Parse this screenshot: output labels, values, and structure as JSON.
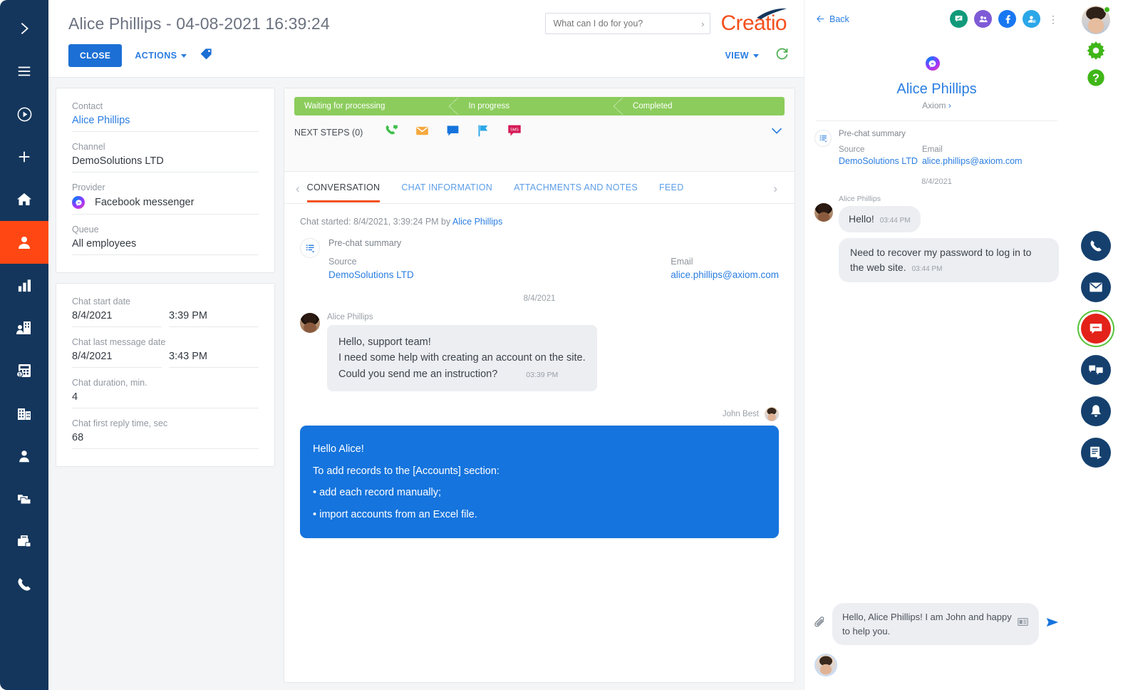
{
  "nav_rail": {
    "items": [
      {
        "name": "expand",
        "icon": "chevron-right-icon"
      },
      {
        "name": "menu",
        "icon": "hamburger-icon"
      },
      {
        "name": "run-process",
        "icon": "play-circle-icon"
      },
      {
        "name": "add",
        "icon": "plus-icon"
      },
      {
        "name": "home",
        "icon": "home-icon"
      },
      {
        "name": "contacts",
        "icon": "person-badge-icon",
        "active": true
      },
      {
        "name": "dashboards",
        "icon": "bar-chart-icon"
      },
      {
        "name": "accounts-people",
        "icon": "building-person-icon"
      },
      {
        "name": "invoices",
        "icon": "calculator-money-icon"
      },
      {
        "name": "companies",
        "icon": "buildings-icon"
      },
      {
        "name": "contact",
        "icon": "person-icon"
      },
      {
        "name": "cases",
        "icon": "folders-icon"
      },
      {
        "name": "portfolio",
        "icon": "briefcase-icon"
      },
      {
        "name": "calls",
        "icon": "phone-icon"
      }
    ]
  },
  "header": {
    "title": "Alice Phillips - 04-08-2021 16:39:24",
    "close_label": "CLOSE",
    "actions_label": "ACTIONS",
    "view_label": "VIEW",
    "tag_icon": "tag-icon",
    "refresh_icon": "refresh-icon",
    "logo_text": "Creatio"
  },
  "search": {
    "placeholder": "What can I do for you?",
    "value": ""
  },
  "info_card_1": {
    "fields": [
      {
        "label": "Contact",
        "value": "Alice Phillips",
        "link": true
      },
      {
        "label": "Channel",
        "value": "DemoSolutions LTD",
        "link": false
      },
      {
        "label": "Provider",
        "value": "Facebook messenger",
        "link": false,
        "icon": "messenger-icon"
      },
      {
        "label": "Queue",
        "value": "All employees",
        "link": false
      }
    ]
  },
  "info_card_2": {
    "chat_start_date_label": "Chat start date",
    "chat_start_date": "8/4/2021",
    "chat_start_time": "3:39 PM",
    "chat_last_message_date_label": "Chat last message date",
    "chat_last_message_date": "8/4/2021",
    "chat_last_message_time": "3:43 PM",
    "chat_duration_label": "Chat duration, min.",
    "chat_duration": "4",
    "chat_first_reply_label": "Chat first reply time, sec",
    "chat_first_reply": "68"
  },
  "process": {
    "stages": [
      {
        "label": "Waiting for processing",
        "color": "#8ccc5c"
      },
      {
        "label": "In progress",
        "color": "#8ccc5c"
      },
      {
        "label": "Completed",
        "color": "#8ccc5c"
      }
    ],
    "next_steps_label": "NEXT STEPS (0)",
    "action_icons": [
      {
        "name": "call-icon",
        "color": "#3fbf4a"
      },
      {
        "name": "email-icon",
        "color": "#f5a83c"
      },
      {
        "name": "message-icon",
        "color": "#1574dd"
      },
      {
        "name": "flag-icon",
        "color": "#2ba7e8"
      },
      {
        "name": "sms-icon",
        "color": "#d41a56"
      }
    ],
    "collapse_icon": "chevron-down-icon"
  },
  "tabs": {
    "prev_icon": "chevron-left-icon",
    "next_icon": "chevron-right-icon",
    "items": [
      {
        "label": "CONVERSATION",
        "active": true
      },
      {
        "label": "CHAT INFORMATION",
        "active": false
      },
      {
        "label": "ATTACHMENTS AND NOTES",
        "active": false
      },
      {
        "label": "FEED",
        "active": false
      }
    ]
  },
  "conversation": {
    "started_prefix": "Chat started: 8/4/2021, 3:39:24 PM by ",
    "started_by": "Alice Phillips",
    "prechat": {
      "title": "Pre-chat summary",
      "source_label": "Source",
      "source_value": "DemoSolutions LTD",
      "email_label": "Email",
      "email_value": "alice.phillips@axiom.com",
      "icon": "summary-icon"
    },
    "date_separator": "8/4/2021",
    "messages": [
      {
        "direction": "in",
        "author": "Alice Phillips",
        "lines": [
          "Hello, support team!",
          "I need some help with creating an account on the site.",
          "Could you send me an instruction?"
        ],
        "time": "03:39 PM"
      },
      {
        "direction": "out",
        "author": "John Best",
        "lines": [
          "Hello Alice!",
          "",
          " To add records to the [Accounts] section:",
          "",
          "• add each record manually;",
          "",
          "• import accounts from an Excel file."
        ],
        "time": ""
      }
    ]
  },
  "chat_panel": {
    "back_label": "Back",
    "header_icons": [
      {
        "name": "chat-approve-icon",
        "color": "#119a7a"
      },
      {
        "name": "group-icon",
        "color": "#7e5bd6"
      },
      {
        "name": "facebook-icon",
        "color": "#1877f2"
      },
      {
        "name": "assign-user-icon",
        "color": "#2ba7e8"
      }
    ],
    "more_icon": "kebab-menu-icon",
    "contact_name": "Alice Phillips",
    "account_name": "Axiom",
    "provider_badge": "messenger-icon",
    "prechat": {
      "title": "Pre-chat summary",
      "source_label": "Source",
      "source_value": "DemoSolutions LTD",
      "email_label": "Email",
      "email_value": "alice.phillips@axiom.com",
      "icon": "summary-icon"
    },
    "date_separator": "8/4/2021",
    "messages": [
      {
        "author": "Alice Phillips",
        "text": "Hello!",
        "time": "03:44 PM",
        "wide": false
      },
      {
        "author": "",
        "text": "Need to recover my password to log in to the web site.",
        "time": "03:44 PM",
        "wide": true
      }
    ],
    "composer": {
      "value": "Hello, Alice Phillips! I am John and happy to help you.",
      "attach_icon": "paperclip-icon",
      "template_icon": "template-icon",
      "send_icon": "send-icon"
    }
  },
  "right_rail": {
    "avatar_name": "user-avatar",
    "online": true,
    "gear_icon": "gear-icon",
    "help_icon": "help-icon",
    "buttons": [
      {
        "name": "phone-icon",
        "active": false
      },
      {
        "name": "email-icon",
        "active": false
      },
      {
        "name": "chat-icon",
        "active": true
      },
      {
        "name": "chats-icon",
        "active": false
      },
      {
        "name": "notifications-icon",
        "active": false
      },
      {
        "name": "feed-icon",
        "active": false
      }
    ]
  },
  "colors": {
    "nav_bg": "#14365c",
    "nav_active": "#ff4713",
    "accent_blue": "#1574dd",
    "link_blue": "#2a7de1",
    "process_green": "#8ccc5c",
    "brand_orange": "#f4501e",
    "tab_underline": "#f4501e",
    "chat_active_red": "#e32219"
  }
}
